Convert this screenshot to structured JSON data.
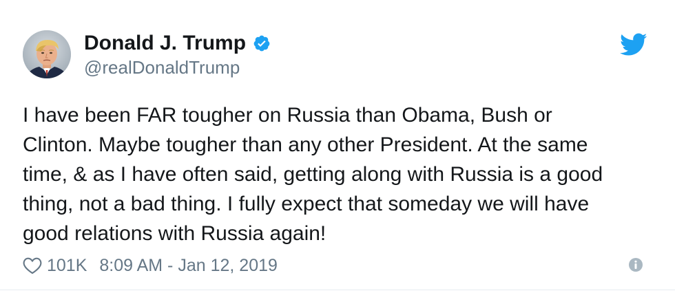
{
  "user": {
    "display_name": "Donald J. Trump",
    "handle": "@realDonaldTrump",
    "verified": true
  },
  "tweet": {
    "text_lines": [
      "I have been FAR tougher on Russia than Obama, Bush or",
      "Clinton. Maybe tougher than any other President. At the same",
      "time, & as I have often said, getting along with Russia is a good",
      "thing, not a bad thing. I fully expect that someday we will have",
      "good relations with Russia again!"
    ]
  },
  "footer": {
    "like_count": "101K",
    "timestamp": "8:09 AM - Jan 12, 2019"
  },
  "icons": {
    "verified": "verified-badge-icon",
    "brand": "twitter-bird-icon",
    "like": "heart-icon",
    "info": "info-icon"
  },
  "colors": {
    "brand_blue": "#1da1f2",
    "text_primary": "#14171a",
    "text_secondary": "#657786",
    "info_gray": "#aab8c2"
  }
}
